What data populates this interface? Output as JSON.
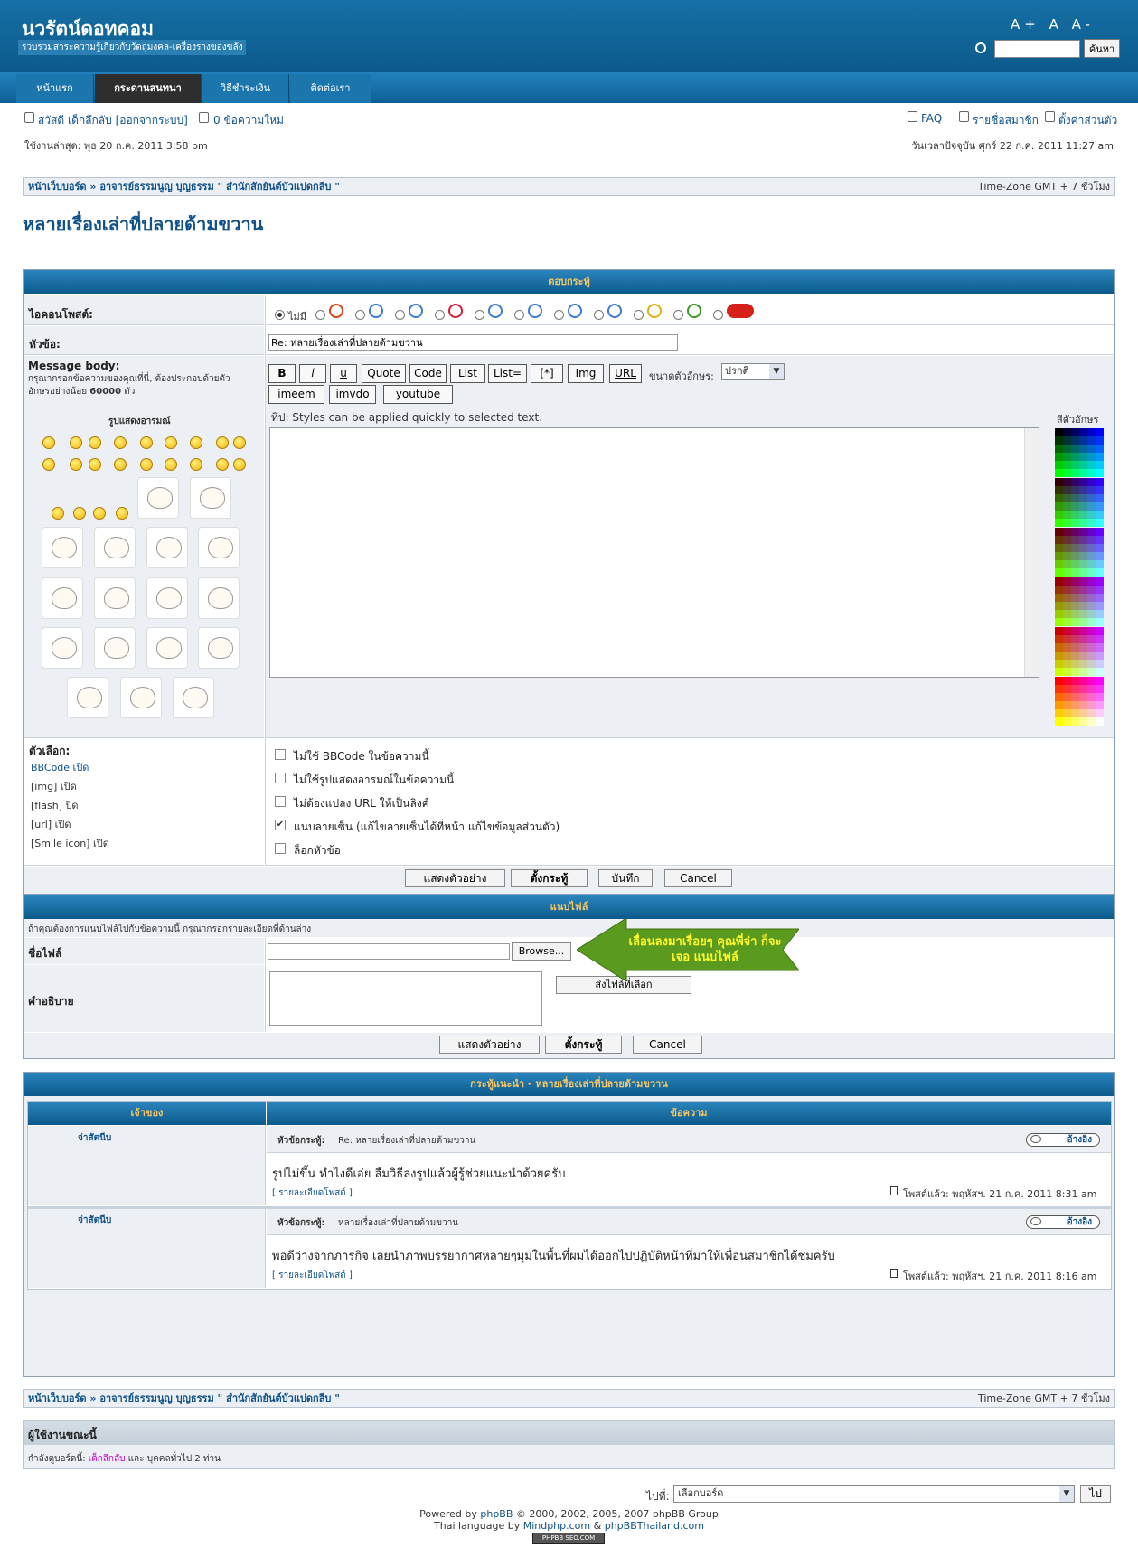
{
  "site": {
    "name": "นวรัตน์ดอทคอม",
    "description": "รวบรวมสาระความรู้เกี่ยวกับวัตถุมงคล-เครื่องรางของขลัง",
    "font_size_label": "A+ A A-",
    "search_button": "ค้นหา",
    "search_value": ""
  },
  "nav": {
    "tabs": [
      "หน้าแรก",
      "กระดานสนทนา",
      "วิธีชำระเงิน",
      "ติดต่อเรา"
    ]
  },
  "user": {
    "greeting": "สวัสดี เด็กลึกลับ",
    "logout": "[ออกจากระบบ]",
    "new_msgs": "0 ข้อความใหม่",
    "last_visit": "ใช้งานล่าสุด: พุธ 20 ก.ค. 2011 3:58 pm",
    "now": "วันเวลาปัจจุบัน ศุกร์ 22 ก.ค. 2011 11:27 am",
    "faq": "FAQ",
    "members": "รายชื่อสมาชิก",
    "profile": "ตั้งค่าส่วนตัว"
  },
  "breadcrumb": {
    "home": "หน้าเว็บบอร์ด",
    "sep": "»",
    "forum": "อาจารย์ธรรมนูญ บุญธรรม \" สำนักสักยันต์บัวแปดกลีบ \"",
    "timezone": "Time-Zone GMT + 7 ชั่วโมง"
  },
  "topic_title": "หลายเรื่องเล่าที่ปลายด้ามขวาน",
  "reply": {
    "header": "ตอบกระทู้",
    "icon_label": "ไอคอนโพสต์:",
    "no_icon": "ไม่มี",
    "subject_label": "หัวข้อ:",
    "subject_value": "Re: หลายเรื่องเล่าที่ปลายด้ามขวาน",
    "body_label": "Message body:",
    "body_hint": "กรุณากรอกข้อความของคุณที่นี่, ต้องประกอบด้วยตัวอักษรอย่างน้อย",
    "body_min": "60000",
    "body_unit": "ตัว",
    "smilies_label": "รูปแสดงอารมณ์",
    "buttons": [
      "B",
      "i",
      "u",
      "Quote",
      "Code",
      "List",
      "List=",
      "[*]",
      "Img",
      "URL"
    ],
    "buttons2": [
      "imeem",
      "imvdo",
      "youtube"
    ],
    "fontsize_label": "ขนาดตัวอักษร:",
    "fontsize_value": "ปรกติ",
    "tip": "ทิป: Styles can be applied quickly to selected text.",
    "color_label": "สีตัวอักษร",
    "options_label": "ตัวเลือก:",
    "side_opts": [
      "BBCode เปิด",
      "[img] เปิด",
      "[flash] ปิด",
      "[url] เปิด",
      "[Smile icon] เปิด"
    ],
    "checkboxes": [
      {
        "label": "ไม่ใช้ BBCode ในข้อความนี้",
        "checked": false
      },
      {
        "label": "ไม่ใช้รูปแสดงอารมณ์ในข้อความนี้",
        "checked": false
      },
      {
        "label": "ไม่ต้องแปลง URL ให้เป็นลิงค์",
        "checked": false
      },
      {
        "label": "แนบลายเซ็น (แก้ไขลายเซ็นได้ที่หน้า แก้ไขข้อมูลส่วนตัว)",
        "checked": true
      },
      {
        "label": "ล็อกหัวข้อ",
        "checked": false
      }
    ],
    "actions": [
      "แสดงตัวอย่าง",
      "ตั้งกระทู้",
      "บันทึก",
      "Cancel"
    ]
  },
  "attach": {
    "header": "แนบไฟล์",
    "hint": "ถ้าคุณต้องการแนบไฟล์ไปกับข้อความนี้ กรุณากรอกรายละเอียดที่ด้านล่าง",
    "file_label": "ชื่อไฟล์",
    "browse": "Browse...",
    "desc_label": "คำอธิบาย",
    "send": "ส่งไฟล์ที่เลือก",
    "arrow_text": "เลื่อนลงมาเรื่อยๆ คุณพี่จ่า ก็จะเจอ แนบไฟล์",
    "actions": [
      "แสดงตัวอย่าง",
      "ตั้งกระทู้",
      "Cancel"
    ]
  },
  "review": {
    "header": "กระทู้แนะนำ - หลายเรื่องเล่าที่ปลายด้ามขวาน",
    "col_author": "เจ้าของ",
    "col_msg": "ข้อความ",
    "quote_btn": "อ้างอิง",
    "posts": [
      {
        "author": "จ่าสัตนีบ",
        "subject_label": "หัวข้อกระทู้:",
        "subject": "Re: หลายเรื่องเล่าที่ปลายด้ามขวาน",
        "body": "รูปไม่ขึ้น ทำไงดีเอ่ย ลืมวิธีลงรูปแล้วผู้รู้ช่วยแนะนำด้วยครับ",
        "detail": "[ รายละเอียดโพสต์ ]",
        "posted": "โพสต์แล้ว: พฤหัสฯ. 21 ก.ค. 2011 8:31 am"
      },
      {
        "author": "จ่าสัตนีบ",
        "subject_label": "หัวข้อกระทู้:",
        "subject": "หลายเรื่องเล่าที่ปลายด้ามขวาน",
        "body": "พอดีว่างจากภารกิจ เลยนำภาพบรรยากาศหลายๆมุมในพื้นที่ผมได้ออกไปปฏิบัติหน้าที่มาให้เพื่อนสมาชิกได้ชมครับ",
        "detail": "[ รายละเอียดโพสต์ ]",
        "posted": "โพสต์แล้ว: พฤหัสฯ. 21 ก.ค. 2011 8:16 am"
      }
    ]
  },
  "online": {
    "header": "ผู้ใช้งานขณะนี้",
    "text_prefix": "กำลังดูบอร์ดนี้:",
    "user": "เด็กลึกลับ",
    "text_suffix": "และ บุคคลทั่วไป 2 ท่าน"
  },
  "jump": {
    "label": "ไปที่:",
    "value": "เลือกบอร์ด",
    "go": "ไป"
  },
  "footer": {
    "line1_prefix": "Powered by",
    "phpbb": "phpBB",
    "line1_suffix": "© 2000, 2002, 2005, 2007 phpBB Group",
    "line2_prefix": "Thai language by",
    "mindphp": "Mindphp.com",
    "amp": "&",
    "phpbbthai": "phpBBThailand.com",
    "badge": "PHPBB SEO.COM"
  }
}
